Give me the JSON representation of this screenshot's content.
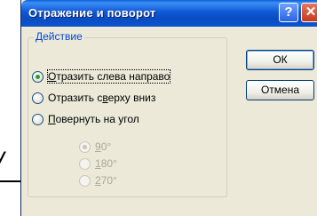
{
  "dialog": {
    "title": "Отражение и поворот",
    "help_glyph": "?",
    "close_glyph": "✕"
  },
  "group": {
    "legend": "Действие",
    "options": [
      {
        "pre": "",
        "u": "О",
        "post": "тразить слева направо",
        "checked": true,
        "enabled": true
      },
      {
        "pre": "Отразить с",
        "u": "в",
        "post": "ерху вниз",
        "checked": false,
        "enabled": true
      },
      {
        "pre": "",
        "u": "П",
        "post": "овернуть на угол",
        "checked": false,
        "enabled": true
      }
    ],
    "angles": [
      {
        "pre": "",
        "u": "9",
        "post": "0°",
        "checked": true
      },
      {
        "pre": "",
        "u": "1",
        "post": "80°",
        "checked": false
      },
      {
        "pre": "",
        "u": "2",
        "post": "70°",
        "checked": false
      }
    ]
  },
  "buttons": {
    "ok": "ОК",
    "cancel": "Отмена"
  },
  "background": {
    "fragment": "л",
    "fragment2": "/"
  }
}
